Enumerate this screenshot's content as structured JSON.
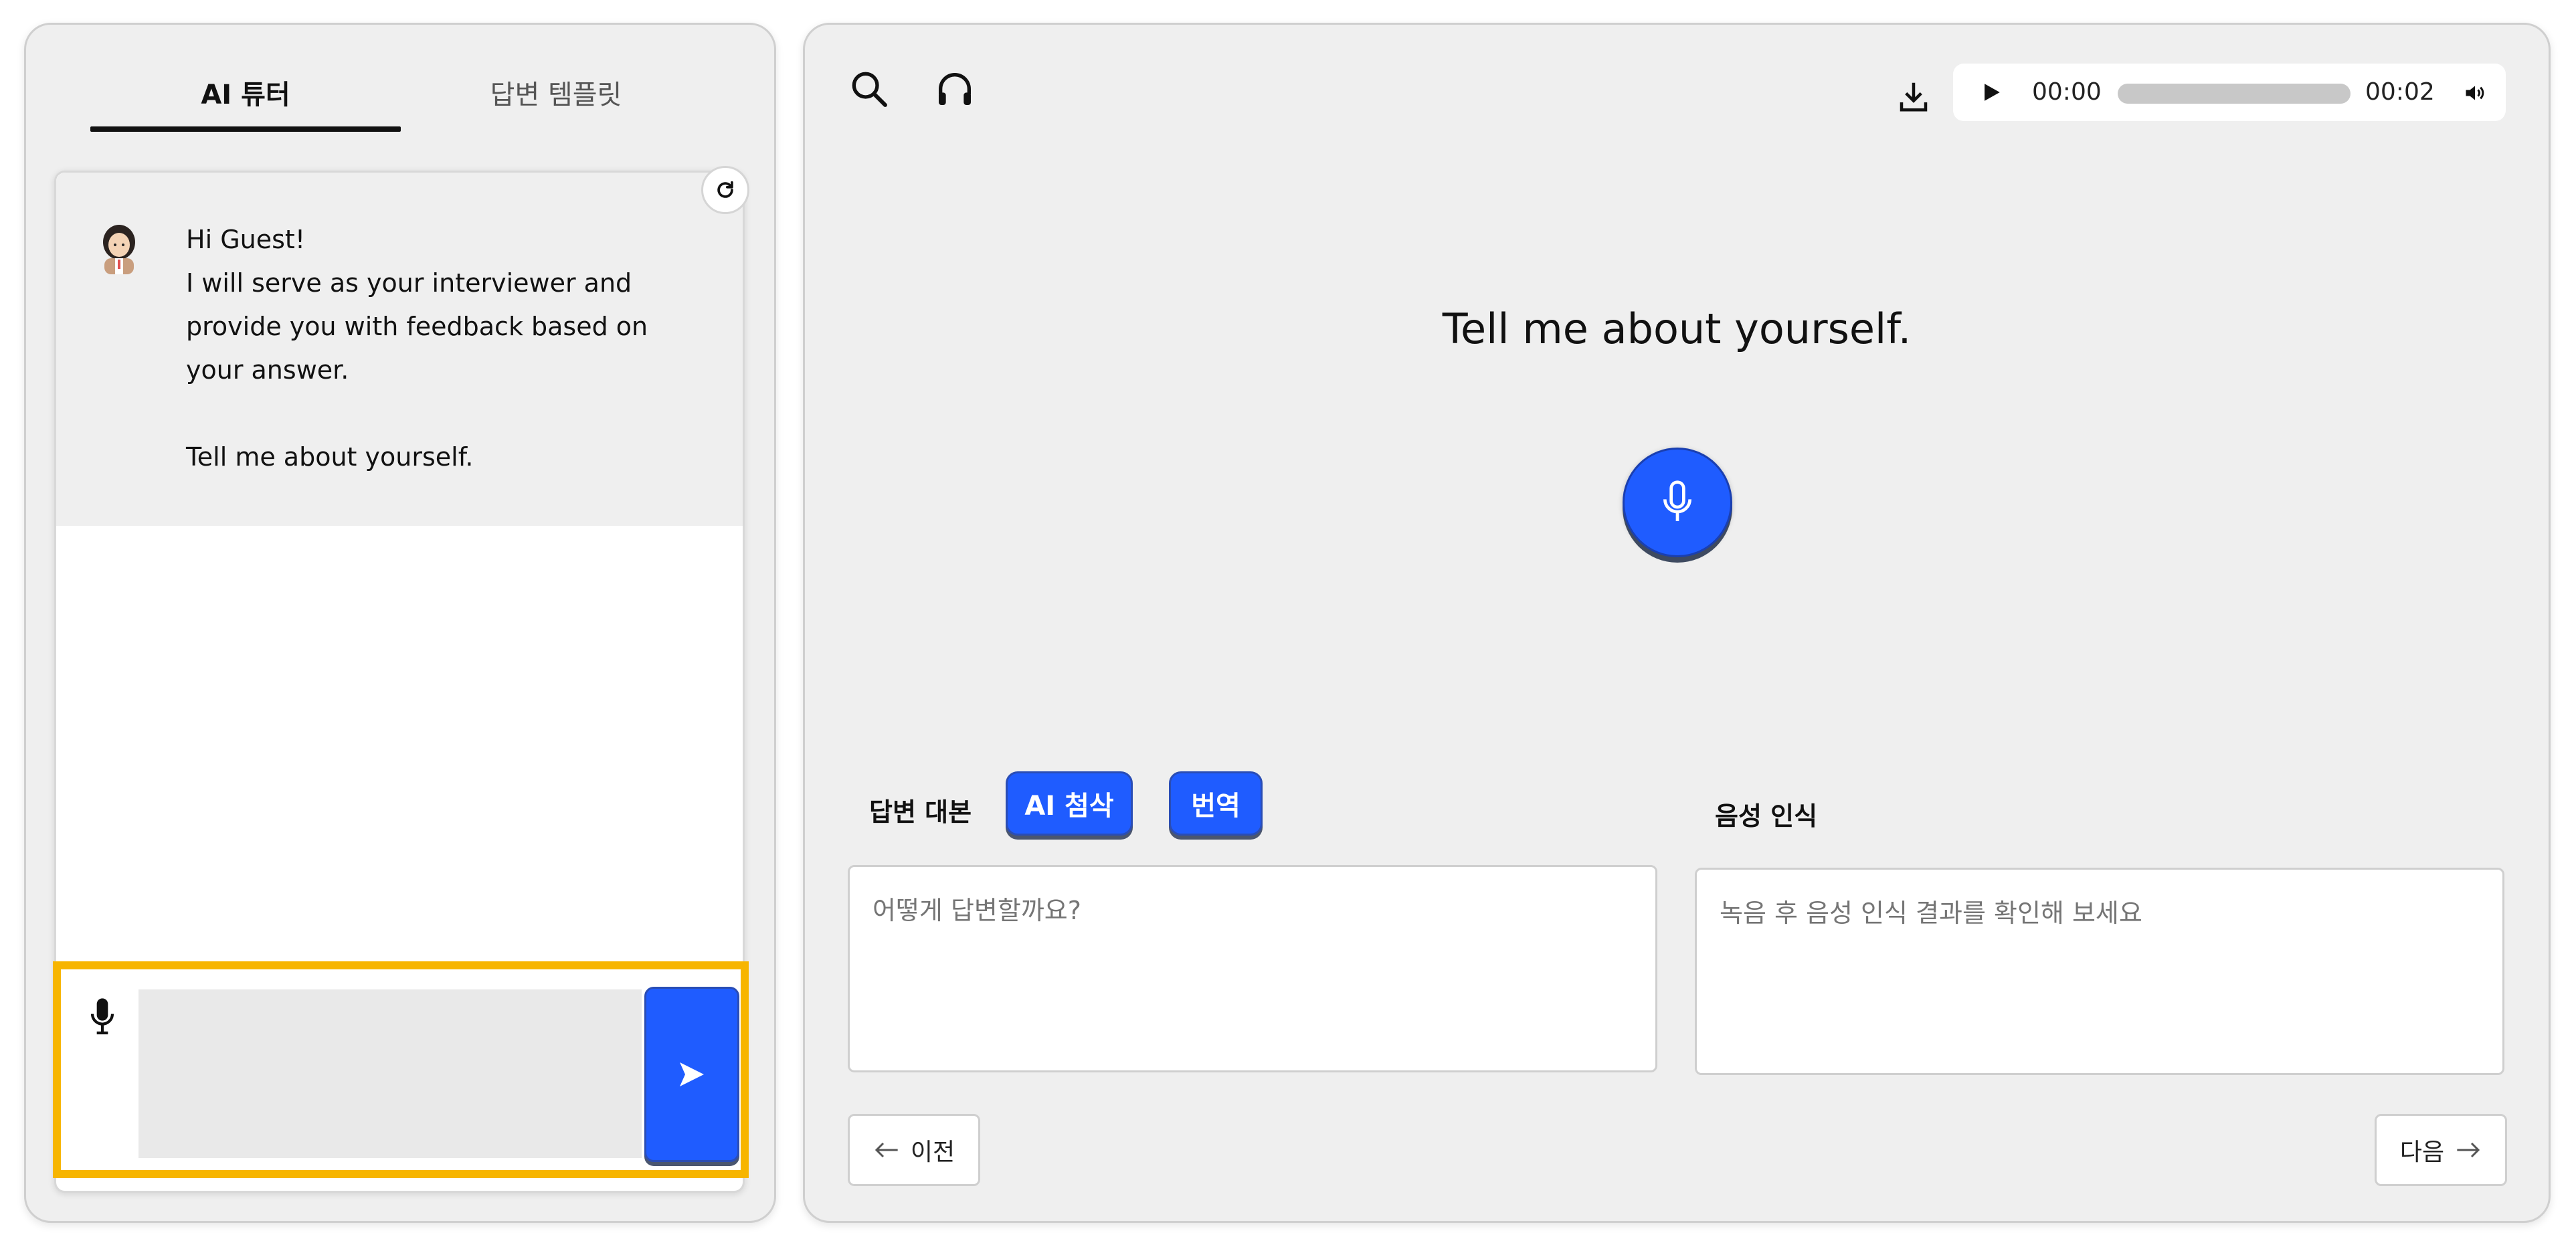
{
  "tabs": {
    "ai_tutor": "AI 튜터",
    "answer_template": "답변 템플릿"
  },
  "chat": {
    "greeting": "Hi Guest!",
    "intro": "I will serve as your interviewer and provide you with feedback based on your answer.",
    "question": "Tell me about yourself."
  },
  "input": {
    "placeholder": ""
  },
  "player": {
    "current_time": "00:00",
    "total_time": "00:02",
    "progress": 0.0
  },
  "main": {
    "question": "Tell me about yourself.",
    "answer_label": "답변 대본",
    "ai_correct_label": "AI 첨삭",
    "translate_label": "번역",
    "recognition_label": "음성 인식",
    "answer_placeholder": "어떻게 답변할까요?",
    "recognition_placeholder": "녹음 후 음성 인식 결과를 확인해 보세요",
    "prev_label": "이전",
    "next_label": "다음"
  },
  "colors": {
    "accent": "#1f5cff",
    "highlight": "#f7b500",
    "panel_bg": "#efefef"
  },
  "icons": [
    "refresh-icon",
    "avatar-icon",
    "mic-icon",
    "send-icon",
    "search-icon",
    "headphones-icon",
    "download-icon",
    "play-icon",
    "volume-icon",
    "arrow-left-icon",
    "arrow-right-icon"
  ]
}
